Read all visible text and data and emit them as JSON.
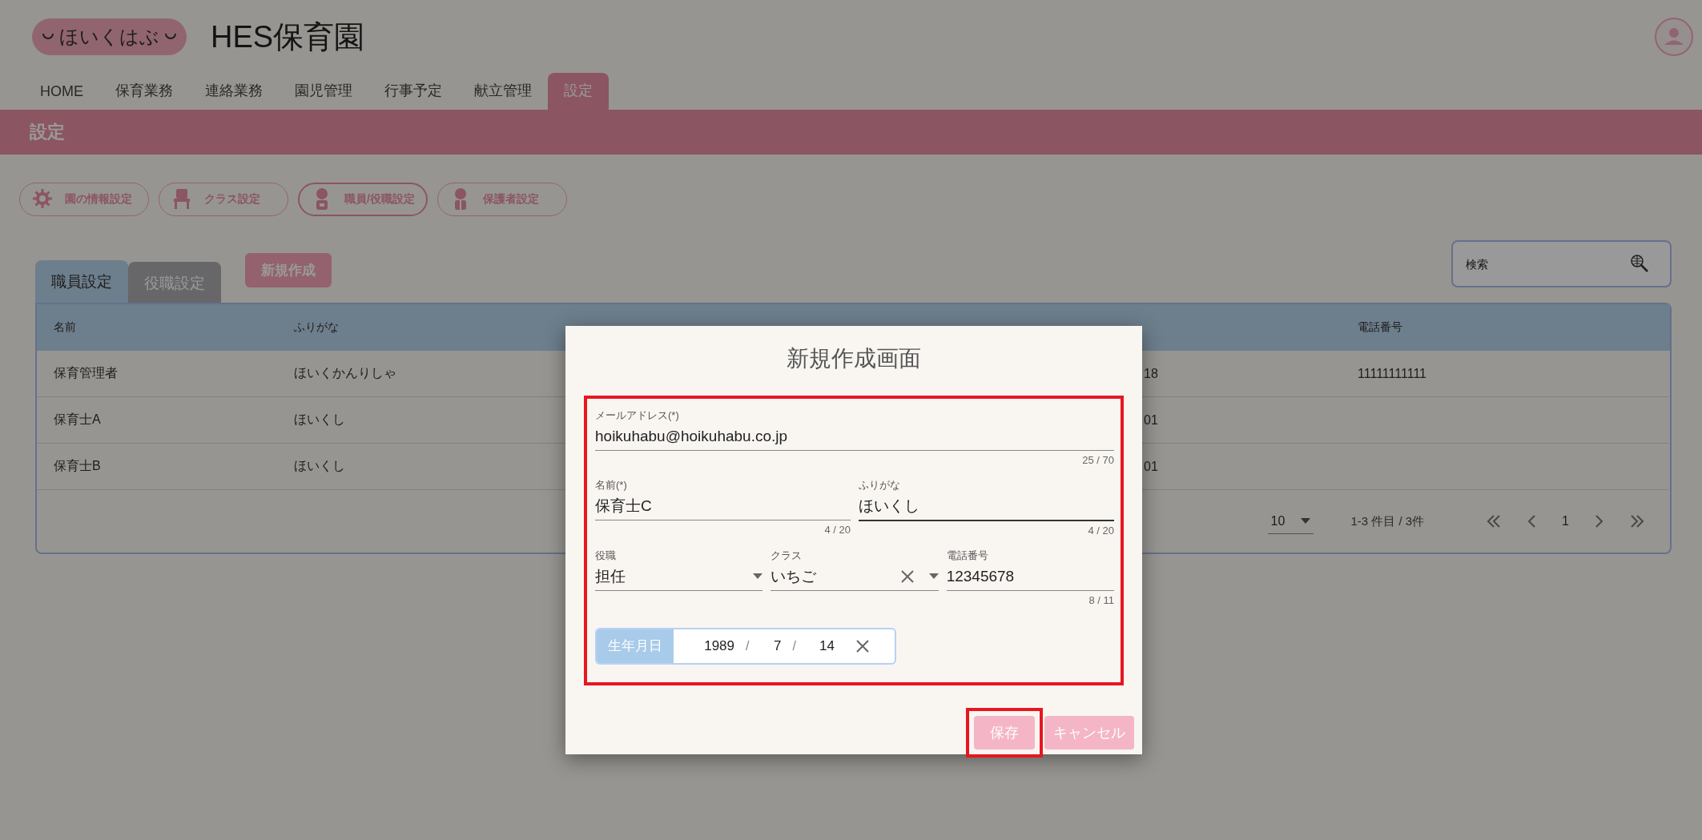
{
  "header": {
    "logo_text": "ほいくはぶ",
    "title": "HES保育園"
  },
  "nav": [
    {
      "label": "HOME",
      "selected": false
    },
    {
      "label": "保育業務",
      "selected": false
    },
    {
      "label": "連絡業務",
      "selected": false
    },
    {
      "label": "園児管理",
      "selected": false
    },
    {
      "label": "行事予定",
      "selected": false
    },
    {
      "label": "献立管理",
      "selected": false
    },
    {
      "label": "設定",
      "selected": true
    }
  ],
  "page_title": "設定",
  "settings_buttons": [
    {
      "label": "園の情報設定",
      "kind": "gear",
      "selected": false
    },
    {
      "label": "クラス設定",
      "kind": "chair",
      "selected": false
    },
    {
      "label": "職員/役職設定",
      "kind": "staff",
      "selected": true
    },
    {
      "label": "保護者設定",
      "kind": "guardian",
      "selected": false
    }
  ],
  "tabs": [
    {
      "label": "職員設定",
      "selected": true
    },
    {
      "label": "役職設定",
      "selected": false
    }
  ],
  "new_button": "新規作成",
  "search": {
    "placeholder": "検索"
  },
  "table": {
    "columns": [
      "名前",
      "ふりがな",
      "電話番号"
    ],
    "rows": [
      {
        "name": "保育管理者",
        "furigana": "ほいくかんりしゃ",
        "birthday": "18",
        "phone": "11111111111"
      },
      {
        "name": "保育士A",
        "furigana": "ほいくし",
        "birthday": "01"
      },
      {
        "name": "保育士B",
        "furigana": "ほいくし",
        "birthday": "01"
      }
    ]
  },
  "pagination": {
    "per_page": "10",
    "range": "1-3 件目 / 3件",
    "page": "1"
  },
  "dialog": {
    "title": "新規作成画面",
    "form_highlighted": true,
    "email_field": {
      "label": "メールアドレス(*)",
      "value": "hoikuhabu@hoikuhabu.co.jp",
      "counter": "25 / 70",
      "focused": false
    },
    "name_fields": [
      {
        "label": "名前(*)",
        "value": "保育士C",
        "counter": "4 / 20",
        "focused": false
      },
      {
        "label": "ふりがな",
        "value": "ほいくし",
        "counter": "4 / 20",
        "focused": true
      }
    ],
    "detail_fields": [
      {
        "kind": "select",
        "label": "役職",
        "value": "担任",
        "clearable": false
      },
      {
        "kind": "select",
        "label": "クラス",
        "value": "いちご",
        "clearable": true
      },
      {
        "kind": "text",
        "label": "電話番号",
        "value": "12345678",
        "counter": "8 / 11",
        "focused": false
      }
    ],
    "birthday": {
      "label": "生年月日",
      "year": "1989",
      "month": "7",
      "day": "14",
      "separator": "/"
    },
    "buttons": [
      {
        "kind": "save",
        "label": "保存",
        "highlighted": true
      },
      {
        "kind": "cancel",
        "label": "キャンセル",
        "highlighted": false
      }
    ]
  }
}
